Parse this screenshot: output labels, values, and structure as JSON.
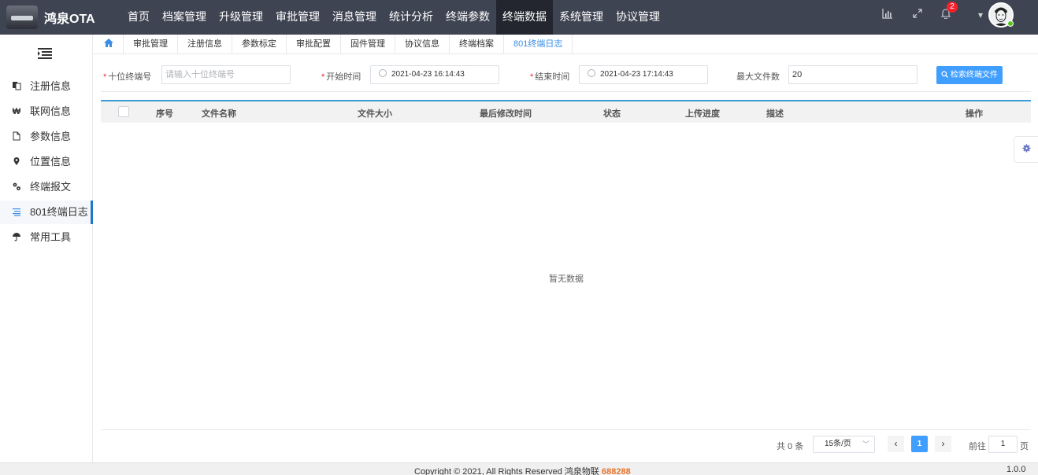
{
  "app": {
    "name": "鸿泉OTA"
  },
  "topnav": [
    {
      "label": "首页"
    },
    {
      "label": "档案管理"
    },
    {
      "label": "升级管理"
    },
    {
      "label": "审批管理"
    },
    {
      "label": "消息管理"
    },
    {
      "label": "统计分析"
    },
    {
      "label": "终端参数"
    },
    {
      "label": "终端数据",
      "active": true
    },
    {
      "label": "系统管理"
    },
    {
      "label": "协议管理"
    }
  ],
  "header": {
    "notification_count": "2"
  },
  "sidebar": {
    "items": [
      {
        "label": "注册信息",
        "icon": "copy-icon"
      },
      {
        "label": "联网信息",
        "icon": "currency-icon"
      },
      {
        "label": "参数信息",
        "icon": "file-icon"
      },
      {
        "label": "位置信息",
        "icon": "location-pin-icon"
      },
      {
        "label": "终端报文",
        "icon": "gear-icon"
      },
      {
        "label": "801终端日志",
        "icon": "list-icon",
        "active": true
      },
      {
        "label": "常用工具",
        "icon": "umbrella-icon"
      }
    ]
  },
  "tabs": [
    {
      "label": "审批管理"
    },
    {
      "label": "注册信息"
    },
    {
      "label": "参数标定"
    },
    {
      "label": "审批配置"
    },
    {
      "label": "固件管理"
    },
    {
      "label": "协议信息"
    },
    {
      "label": "终端档案"
    },
    {
      "label": "801终端日志",
      "active": true
    }
  ],
  "form": {
    "terminal_label": "十位终端号",
    "terminal_placeholder": "请输入十位终端号",
    "start_label": "开始时间",
    "start_value": "2021-04-23 16:14:43",
    "end_label": "结束时间",
    "end_value": "2021-04-23 17:14:43",
    "max_label": "最大文件数",
    "max_value": "20",
    "search_button": "检索终端文件"
  },
  "table": {
    "columns": [
      "序号",
      "文件名称",
      "文件大小",
      "最后修改时间",
      "状态",
      "上传进度",
      "描述",
      "操作"
    ],
    "rows": [],
    "empty_text": "暂无数据"
  },
  "pagination": {
    "total": "共 0 条",
    "page_size": "15条/页",
    "current_page": "1",
    "goto_label": "前往",
    "goto_value": "1",
    "page_suffix": "页"
  },
  "footer": {
    "copyright": "Copyright © 2021, All Rights Reserved 鸿泉物联",
    "code": "688288",
    "version": "1.0.0"
  },
  "colors": {
    "topbar": "#3f4452",
    "active_nav": "#23262e",
    "accent": "#409eff",
    "table_accent": "#3a9bd5"
  }
}
